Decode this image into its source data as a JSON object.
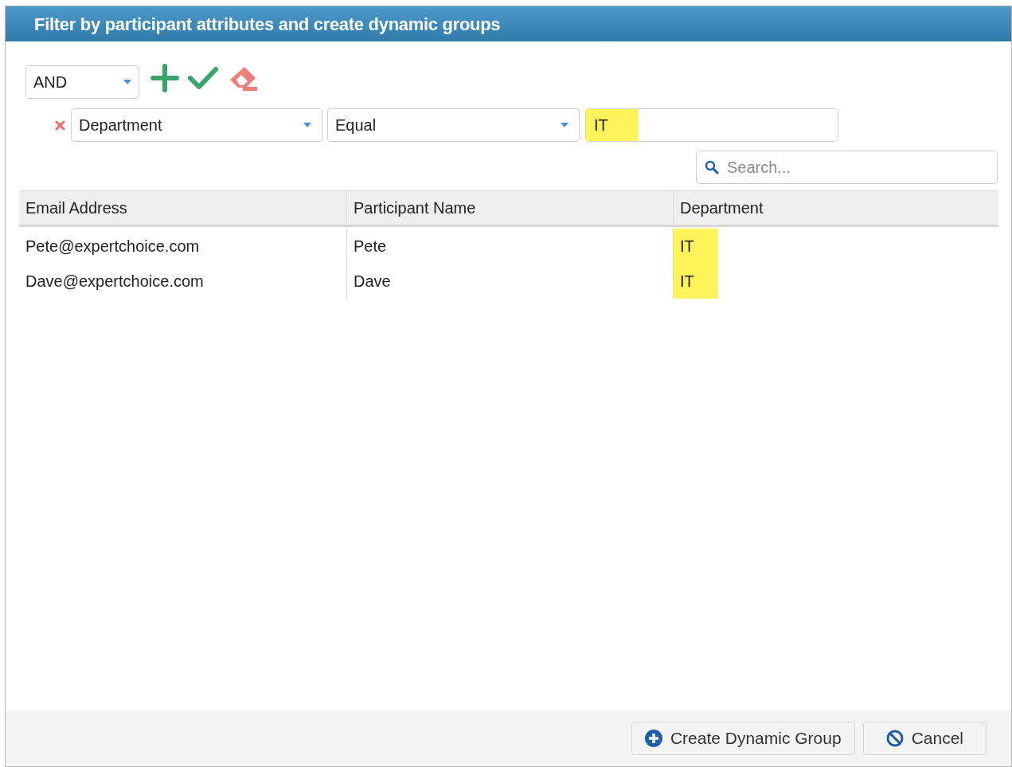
{
  "dialog": {
    "title": "Filter by participant attributes and create dynamic groups"
  },
  "filter": {
    "combinator": "AND",
    "conditions": [
      {
        "attribute": "Department",
        "operator": "Equal",
        "value": "IT",
        "highlighted": true
      }
    ]
  },
  "search": {
    "placeholder": "Search..."
  },
  "table": {
    "columns": [
      "Email Address",
      "Participant Name",
      "Department"
    ],
    "rows": [
      {
        "cells": [
          {
            "text": "Pete@expertchoice.com",
            "highlighted": false
          },
          {
            "text": "Pete",
            "highlighted": false
          },
          {
            "text": "IT",
            "highlighted": true
          }
        ]
      },
      {
        "cells": [
          {
            "text": "Dave@expertchoice.com",
            "highlighted": false
          },
          {
            "text": "Dave",
            "highlighted": false
          },
          {
            "text": "IT",
            "highlighted": true
          }
        ]
      }
    ]
  },
  "buttons": [
    {
      "kind": "create",
      "label": "Create Dynamic Group"
    },
    {
      "kind": "cancel",
      "label": "Cancel"
    }
  ]
}
